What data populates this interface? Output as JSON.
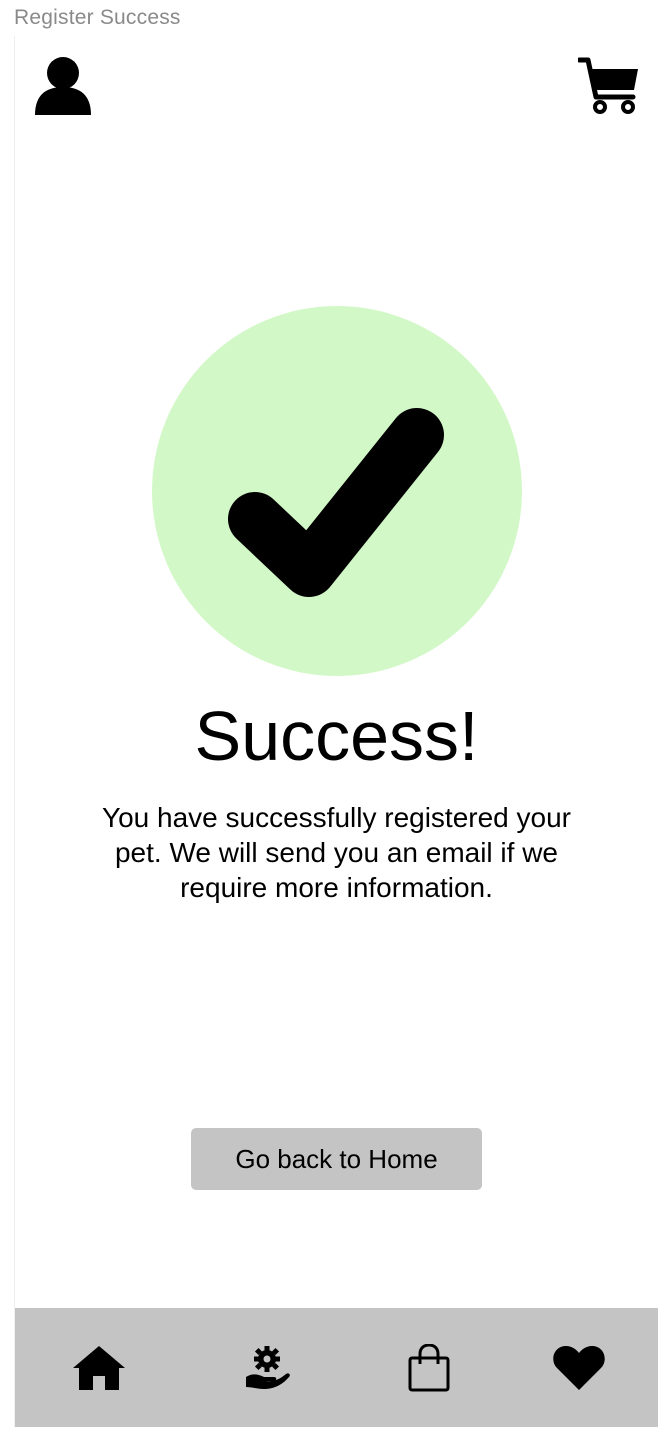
{
  "window": {
    "title": "Register Success"
  },
  "header": {
    "profile_icon": "user-icon",
    "cart_icon": "cart-icon"
  },
  "main": {
    "status_icon": "checkmark-icon",
    "title": "Success!",
    "message": "You have successfully registered your pet. We will send you an email if we require more information.",
    "home_button_label": "Go back to Home"
  },
  "bottom_nav": {
    "items": [
      {
        "icon": "home-icon"
      },
      {
        "icon": "hand-gear-icon"
      },
      {
        "icon": "shopping-bag-icon"
      },
      {
        "icon": "heart-icon"
      }
    ]
  },
  "colors": {
    "success_circle": "#d3f8c8",
    "button_bg": "#c4c4c4",
    "nav_bg": "#c4c4c4",
    "title_text": "#8a8a8a"
  }
}
